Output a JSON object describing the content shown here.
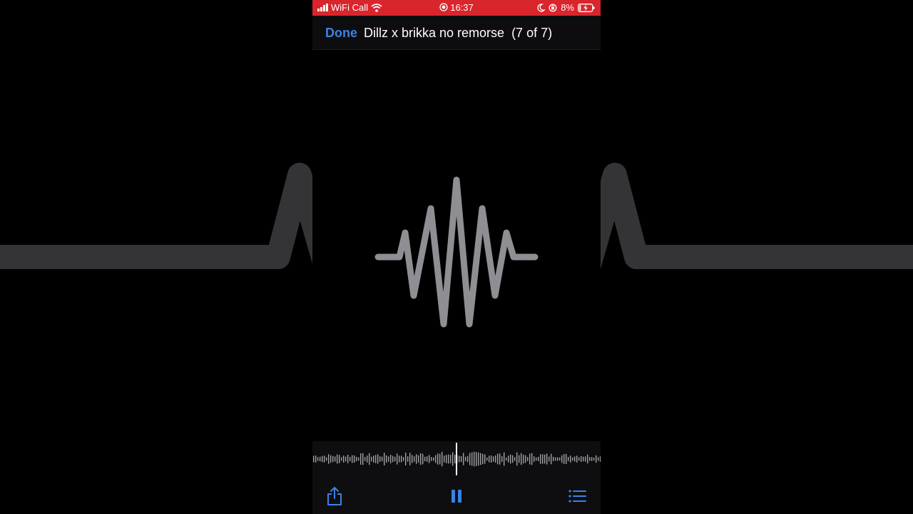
{
  "status_bar": {
    "carrier": "WiFi Call",
    "time": "16:37",
    "battery": "8%",
    "background_color": "#d9252c",
    "icons": [
      "signal-icon",
      "wifi-icon",
      "screen-recording-icon",
      "moon-icon",
      "orientation-lock-icon",
      "battery-charging-icon"
    ]
  },
  "nav": {
    "done_label": "Done",
    "title": "Dillz x brikka no remorse",
    "count": "(7 of 7)"
  },
  "toolbar": {
    "icons": [
      "share-icon",
      "pause-icon",
      "list-icon"
    ],
    "accent_color": "#3b82e6"
  },
  "audio": {
    "playback_progress": 0.5,
    "state": "playing"
  }
}
